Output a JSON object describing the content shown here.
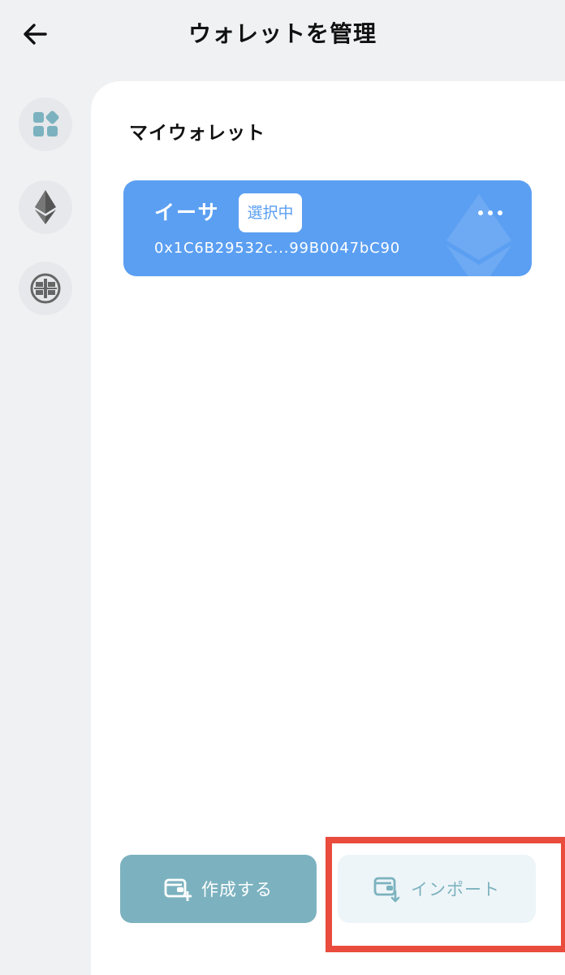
{
  "header": {
    "title": "ウォレットを管理",
    "back_icon": "arrow-left-icon"
  },
  "sidebar": {
    "items": [
      {
        "icon": "apps-grid-icon",
        "selected": false
      },
      {
        "icon": "ethereum-icon",
        "selected": false
      },
      {
        "icon": "circuit-chain-icon",
        "selected": false
      }
    ]
  },
  "section": {
    "title": "マイウォレット"
  },
  "wallet": {
    "name": "イーサ",
    "badge": "選択中",
    "address": "0x1C6B29532c...99B0047bC90",
    "more_icon": "more-horizontal-icon",
    "card_color": "#5b9ff2"
  },
  "actions": {
    "create_label": "作成する",
    "import_label": "インポート",
    "create_icon": "wallet-add-icon",
    "import_icon": "wallet-import-icon",
    "accent_color": "#7cb2bf"
  },
  "annotation": {
    "highlight_color": "#e94b3c"
  }
}
